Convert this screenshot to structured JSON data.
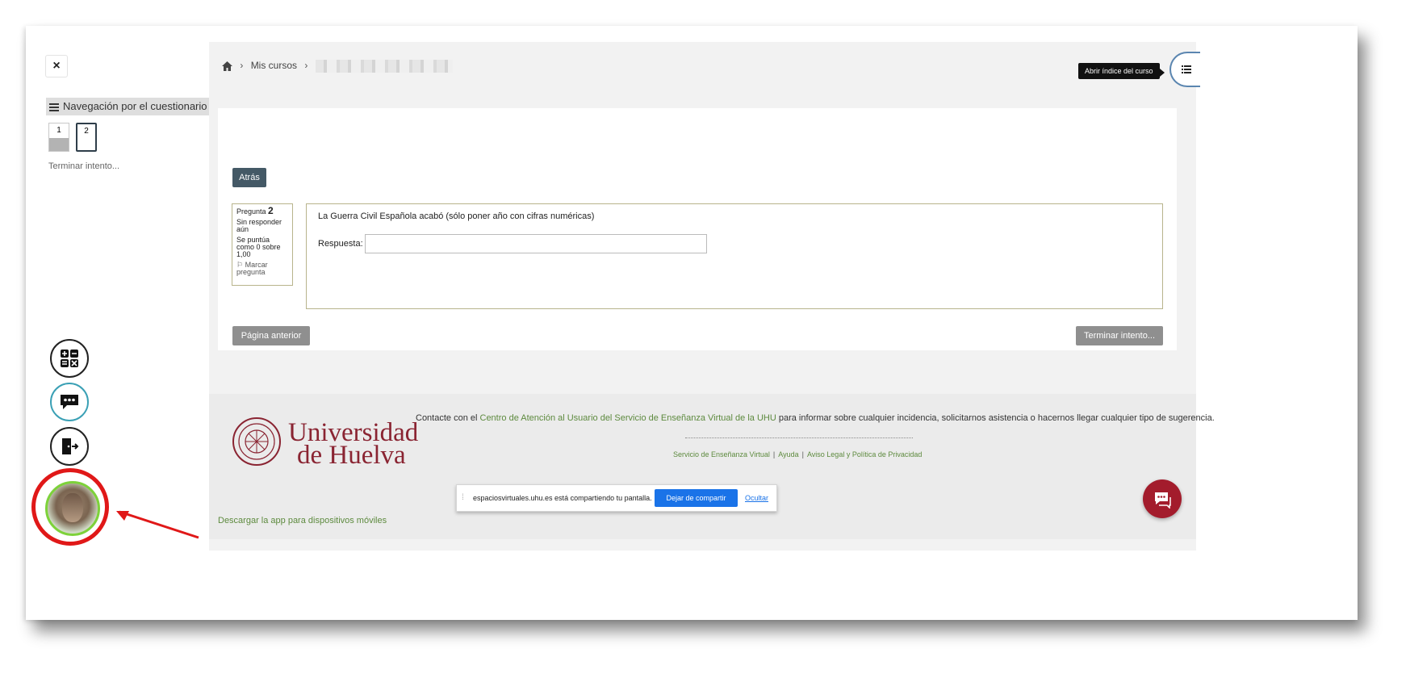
{
  "drawer": {
    "close_label": "×",
    "nav_title": "Navegación por el cuestionario",
    "questions": [
      "1",
      "2"
    ],
    "finish_link": "Terminar intento..."
  },
  "breadcrumb": {
    "my_courses": "Mis cursos"
  },
  "header": {
    "tooltip": "Abrir índice del curso"
  },
  "question": {
    "back_button": "Atrás",
    "label": "Pregunta",
    "number": "2",
    "status": "Sin responder aún",
    "grade": "Se puntúa como 0 sobre 1,00",
    "flag": "Marcar pregunta",
    "text": "La Guerra Civil Española acabó (sólo poner año con cifras numéricas)",
    "answer_label": "Respuesta:",
    "answer_value": ""
  },
  "nav_buttons": {
    "previous": "Página anterior",
    "finish": "Terminar intento..."
  },
  "footer": {
    "logo_line1": "Universidad",
    "logo_line2": "de Huelva",
    "contact_prefix": "Contacte con el",
    "contact_link": "Centro de Atención al Usuario del Servicio de Enseñanza Virtual de la UHU",
    "contact_suffix": "para informar sobre cualquier incidencia, solicitarnos asistencia o hacernos llegar cualquier tipo de sugerencia.",
    "link_service": "Servicio de Enseñanza Virtual",
    "link_help": "Ayuda",
    "link_legal": "Aviso Legal y Política de Privacidad",
    "app_link": "Descargar la app para dispositivos móviles"
  },
  "share_bar": {
    "message": "espaciosvirtuales.uhu.es está compartiendo tu pantalla.",
    "stop": "Dejar de compartir",
    "hide": "Ocultar"
  },
  "colors": {
    "primary_dark": "#445966",
    "link_green": "#5d8a3e",
    "brand_red": "#8a2432",
    "annotation_red": "#e01818",
    "share_blue": "#1a73e8"
  },
  "icons": [
    "close-icon",
    "menu-icon",
    "home-icon",
    "list-icon",
    "calculator-icon",
    "chat-icon",
    "exit-icon",
    "flag-icon",
    "help-chat-icon",
    "arrow-annotation"
  ]
}
